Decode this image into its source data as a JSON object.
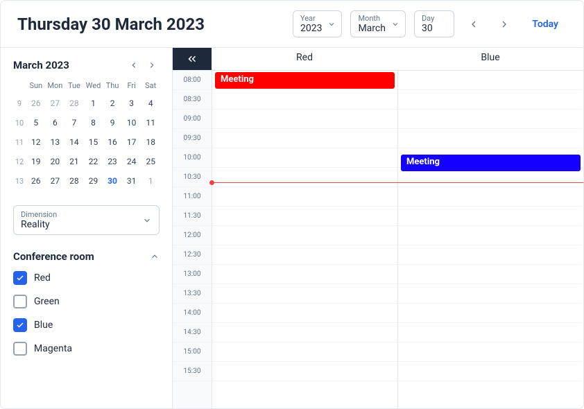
{
  "header": {
    "title": "Thursday 30 March 2023",
    "year": {
      "label": "Year",
      "value": "2023"
    },
    "month": {
      "label": "Month",
      "value": "March"
    },
    "day": {
      "label": "Day",
      "value": "30"
    },
    "today": "Today"
  },
  "miniCalendar": {
    "title": "March 2023",
    "dow": [
      "Sun",
      "Mon",
      "Tue",
      "Wed",
      "Thu",
      "Fri",
      "Sat"
    ],
    "weeks": [
      {
        "wk": "9",
        "days": [
          {
            "n": "26",
            "other": true
          },
          {
            "n": "27",
            "other": true
          },
          {
            "n": "28",
            "other": true
          },
          {
            "n": "1"
          },
          {
            "n": "2"
          },
          {
            "n": "3"
          },
          {
            "n": "4"
          }
        ]
      },
      {
        "wk": "10",
        "days": [
          {
            "n": "5"
          },
          {
            "n": "6"
          },
          {
            "n": "7"
          },
          {
            "n": "8"
          },
          {
            "n": "9"
          },
          {
            "n": "10"
          },
          {
            "n": "11"
          }
        ]
      },
      {
        "wk": "11",
        "days": [
          {
            "n": "12"
          },
          {
            "n": "13"
          },
          {
            "n": "14"
          },
          {
            "n": "15"
          },
          {
            "n": "16"
          },
          {
            "n": "17"
          },
          {
            "n": "18"
          }
        ]
      },
      {
        "wk": "12",
        "days": [
          {
            "n": "19"
          },
          {
            "n": "20"
          },
          {
            "n": "21"
          },
          {
            "n": "22"
          },
          {
            "n": "23"
          },
          {
            "n": "24"
          },
          {
            "n": "25"
          }
        ]
      },
      {
        "wk": "13",
        "days": [
          {
            "n": "26"
          },
          {
            "n": "27"
          },
          {
            "n": "28"
          },
          {
            "n": "29"
          },
          {
            "n": "30",
            "selected": true
          },
          {
            "n": "31"
          },
          {
            "n": "1",
            "other": true
          }
        ]
      }
    ]
  },
  "dimension": {
    "label": "Dimension",
    "value": "Reality"
  },
  "roomsSection": {
    "title": "Conference room"
  },
  "rooms": [
    {
      "name": "Red",
      "checked": true
    },
    {
      "name": "Green",
      "checked": false
    },
    {
      "name": "Blue",
      "checked": true
    },
    {
      "name": "Magenta",
      "checked": false
    }
  ],
  "schedule": {
    "columns": [
      "Red",
      "Blue"
    ],
    "times": [
      "08:00",
      "08:30",
      "09:00",
      "09:30",
      "10:00",
      "10:30",
      "11:00",
      "11:30",
      "12:00",
      "12:30",
      "13:00",
      "13:30",
      "14:00",
      "14:30",
      "15:00",
      "15:30"
    ],
    "nowSlotIndex": 5.75,
    "events": [
      {
        "column": 0,
        "label": "Meeting",
        "startSlot": 0,
        "span": 1,
        "color": "#ff0000"
      },
      {
        "column": 1,
        "label": "Meeting",
        "startSlot": 4.25,
        "span": 1,
        "color": "#1400ff"
      }
    ]
  }
}
